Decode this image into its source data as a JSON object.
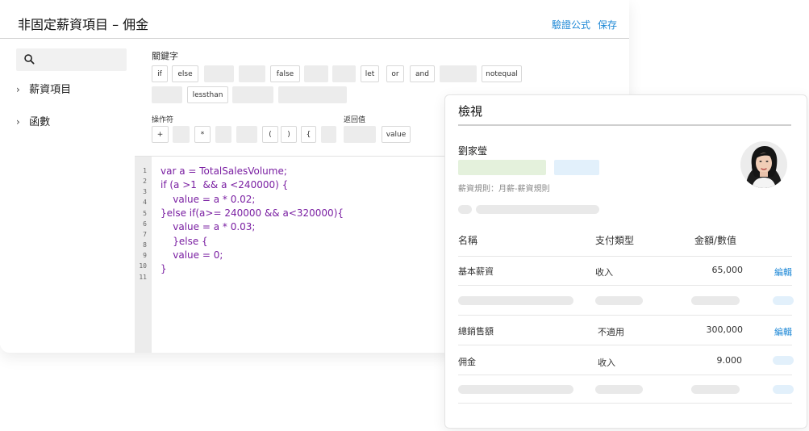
{
  "editor": {
    "title": "非固定薪資項目 – 佣金",
    "verify_label": "驗證公式",
    "save_label": "保存"
  },
  "sidebar": {
    "search_icon": "search-icon",
    "items": [
      {
        "label": "薪資項目"
      },
      {
        "label": "函數"
      }
    ]
  },
  "palette": {
    "keywords_label": "關鍵字",
    "keywords": [
      "if",
      "else",
      "false",
      "let",
      "or",
      "and",
      "notequal",
      "lessthan"
    ],
    "operators_label": "操作符",
    "operators": [
      "+",
      "*",
      "(",
      ")",
      "{"
    ],
    "return_label": "返回值",
    "return_chip": "value"
  },
  "code": {
    "line_numbers": [
      "1",
      "2",
      "3",
      "4",
      "5",
      "6",
      "7",
      "8",
      "9",
      "10",
      "11"
    ],
    "lines": [
      "var a = TotalSalesVolume;",
      "if (a >1  && a <240000) {",
      "    value = a * 0.02;",
      "}else if(a>= 240000 && a<320000){",
      "    value = a * 0.03;",
      "    }else {",
      "    value = 0;",
      "}"
    ]
  },
  "preview": {
    "title": "檢視",
    "employee_name": "劉家瑩",
    "rule_text": "薪資規則：月薪-薪資規則",
    "columns": [
      "名稱",
      "支付類型",
      "金額/數值"
    ],
    "rows": [
      {
        "name": "基本薪資",
        "type": "收入",
        "amount": "65,000",
        "action": "編輯"
      },
      {
        "name": "總銷售額",
        "type": "不適用",
        "amount": "300,000",
        "action": "編輯"
      },
      {
        "name": "佣金",
        "type": "收入",
        "amount": "9.000",
        "action": ""
      }
    ]
  },
  "colors": {
    "link": "#1e88d6",
    "keyword": "#7a1fa2"
  }
}
